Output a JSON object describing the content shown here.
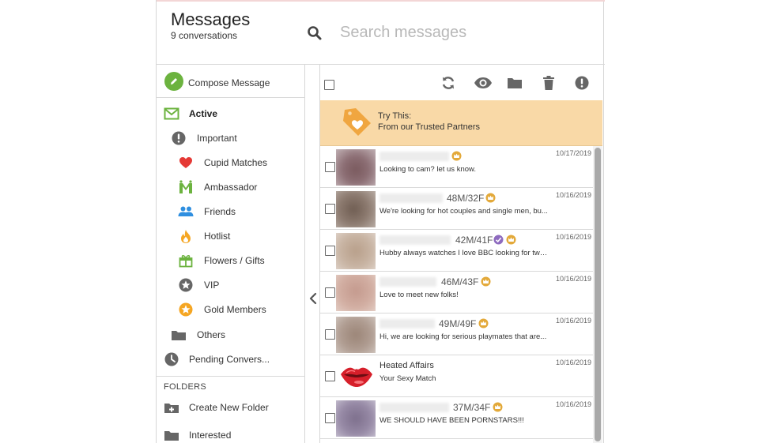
{
  "header": {
    "title": "Messages",
    "subtitle": "9 conversations",
    "search_placeholder": "Search messages"
  },
  "sidebar": {
    "compose_label": "Compose Message",
    "items": [
      {
        "label": "Active",
        "icon": "envelope-icon"
      },
      {
        "label": "Important",
        "icon": "exclamation-icon"
      },
      {
        "label": "Cupid Matches",
        "icon": "heart-icon"
      },
      {
        "label": "Ambassador",
        "icon": "ambassador-icon"
      },
      {
        "label": "Friends",
        "icon": "friends-icon"
      },
      {
        "label": "Hotlist",
        "icon": "flame-icon"
      },
      {
        "label": "Flowers / Gifts",
        "icon": "gift-icon"
      },
      {
        "label": "VIP",
        "icon": "star-icon"
      },
      {
        "label": "Gold Members",
        "icon": "gold-star-icon"
      },
      {
        "label": "Others",
        "icon": "folder-icon"
      },
      {
        "label": "Pending Convers...",
        "icon": "clock-icon"
      }
    ],
    "folders_heading": "FOLDERS",
    "folders": [
      {
        "label": "Create New Folder",
        "icon": "folder-plus-icon"
      },
      {
        "label": "Interested",
        "icon": "folder-icon"
      }
    ]
  },
  "promo": {
    "line1": "Try This:",
    "line2": "From our Trusted Partners"
  },
  "messages": [
    {
      "ages": "",
      "date": "10/17/2019",
      "snippet": "Looking to cam? let us know.",
      "verified": false
    },
    {
      "ages": "48M/32F",
      "date": "10/16/2019",
      "snippet": "We're looking for hot couples and single men, bu...",
      "verified": false
    },
    {
      "ages": "42M/41F",
      "date": "10/16/2019",
      "snippet": "Hubby always watches I love BBC looking for two...",
      "verified": true
    },
    {
      "ages": "46M/43F",
      "date": "10/16/2019",
      "snippet": "Love to meet new folks!",
      "verified": false
    },
    {
      "ages": "49M/49F",
      "date": "10/16/2019",
      "snippet": "Hi, we are looking for serious playmates that are...",
      "verified": false
    },
    {
      "name": "Heated Affairs",
      "date": "10/16/2019",
      "snippet": "Your Sexy Match",
      "verified": false
    },
    {
      "ages": "37M/34F",
      "date": "10/16/2019",
      "snippet": "WE SHOULD HAVE BEEN PORNSTARS!!!",
      "verified": false
    }
  ],
  "colors": {
    "compose_green": "#6cb33f",
    "promo_bg": "#f9d9a7",
    "promo_icon": "#f0a640",
    "crown_gold": "#e3a93a",
    "verified_purple": "#8e6bbf",
    "icon_gray": "#666666"
  }
}
